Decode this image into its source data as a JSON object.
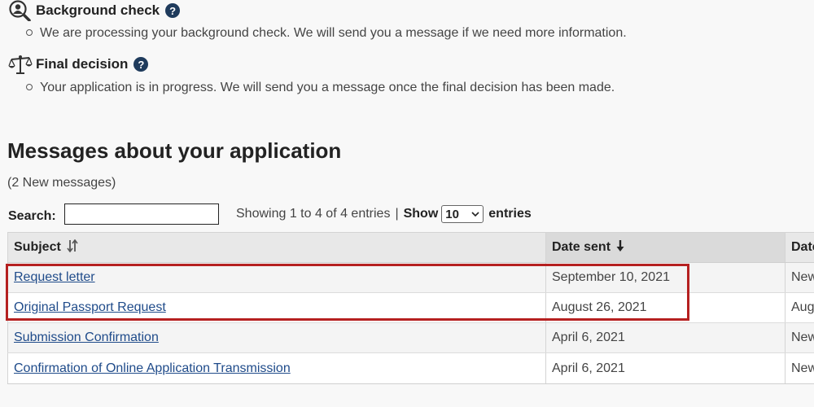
{
  "status_sections": [
    {
      "title": "Background check",
      "icon": "magnifier-person-icon",
      "detail": "We are processing your background check. We will send you a message if we need more information."
    },
    {
      "title": "Final decision",
      "icon": "scales-icon",
      "detail": "Your application is in progress. We will send you a message once the final decision has been made."
    }
  ],
  "help_glyph": "?",
  "messages": {
    "title": "Messages about your application",
    "new_count_text": "(2 New messages)",
    "search_label": "Search:",
    "search_value": "",
    "showing_text": "Showing 1 to 4 of 4 entries",
    "separator": "|",
    "show_label": "Show",
    "page_size": "10",
    "entries_label": "entries",
    "columns": [
      "Subject",
      "Date sent",
      "Date"
    ],
    "rows": [
      {
        "subject": "Request letter",
        "date_sent": "September 10, 2021",
        "date": "New"
      },
      {
        "subject": "Original Passport Request",
        "date_sent": "August 26, 2021",
        "date": "Aug"
      },
      {
        "subject": "Submission Confirmation",
        "date_sent": "April 6, 2021",
        "date": "New"
      },
      {
        "subject": "Confirmation of Online Application Transmission",
        "date_sent": "April 6, 2021",
        "date": "New"
      }
    ]
  },
  "colors": {
    "link": "#1f4b8a",
    "help_icon_bg": "#1f3b5c",
    "highlight": "#b52020"
  }
}
